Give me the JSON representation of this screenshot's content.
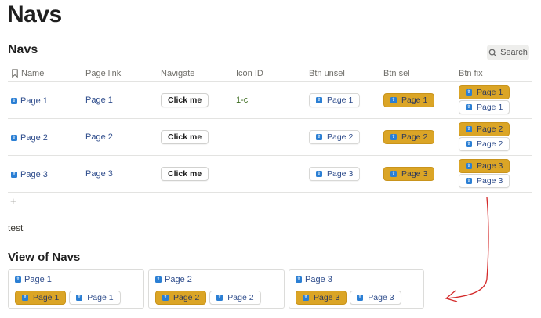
{
  "page": {
    "title": "Navs"
  },
  "db": {
    "title": "Navs",
    "search_label": "Search",
    "columns": [
      "Name",
      "Page link",
      "Navigate",
      "Icon ID",
      "Btn unsel",
      "Btn sel",
      "Btn fix"
    ],
    "rows": [
      {
        "name": "Page 1",
        "page_link": "Page 1",
        "navigate": "Click me",
        "icon_id": "1-c",
        "btn_unsel": "Page 1",
        "btn_sel": "Page 1",
        "btn_fix_sel": "Page 1",
        "btn_fix_unsel": "Page 1"
      },
      {
        "name": "Page 2",
        "page_link": "Page 2",
        "navigate": "Click me",
        "icon_id": "",
        "btn_unsel": "Page 2",
        "btn_sel": "Page 2",
        "btn_fix_sel": "Page 2",
        "btn_fix_unsel": "Page 2"
      },
      {
        "name": "Page 3",
        "page_link": "Page 3",
        "navigate": "Click me",
        "icon_id": "",
        "btn_unsel": "Page 3",
        "btn_sel": "Page 3",
        "btn_fix_sel": "Page 3",
        "btn_fix_unsel": "Page 3"
      }
    ],
    "add_label": "+"
  },
  "text_block": "test",
  "view": {
    "title": "View of Navs",
    "cards": [
      {
        "title": "Page 1",
        "sel": "Page 1",
        "unsel": "Page 1"
      },
      {
        "title": "Page 2",
        "sel": "Page 2",
        "unsel": "Page 2"
      },
      {
        "title": "Page 3",
        "sel": "Page 3",
        "unsel": "Page 3"
      }
    ]
  },
  "colors": {
    "selected": "#dba526",
    "link": "#2f4d8c",
    "page_icon": "#2b7fd4",
    "annotation_arrow": "#d42a2a"
  },
  "icons": {
    "page": "page-icon",
    "search": "search-icon",
    "name_column": "bookmark-icon"
  }
}
